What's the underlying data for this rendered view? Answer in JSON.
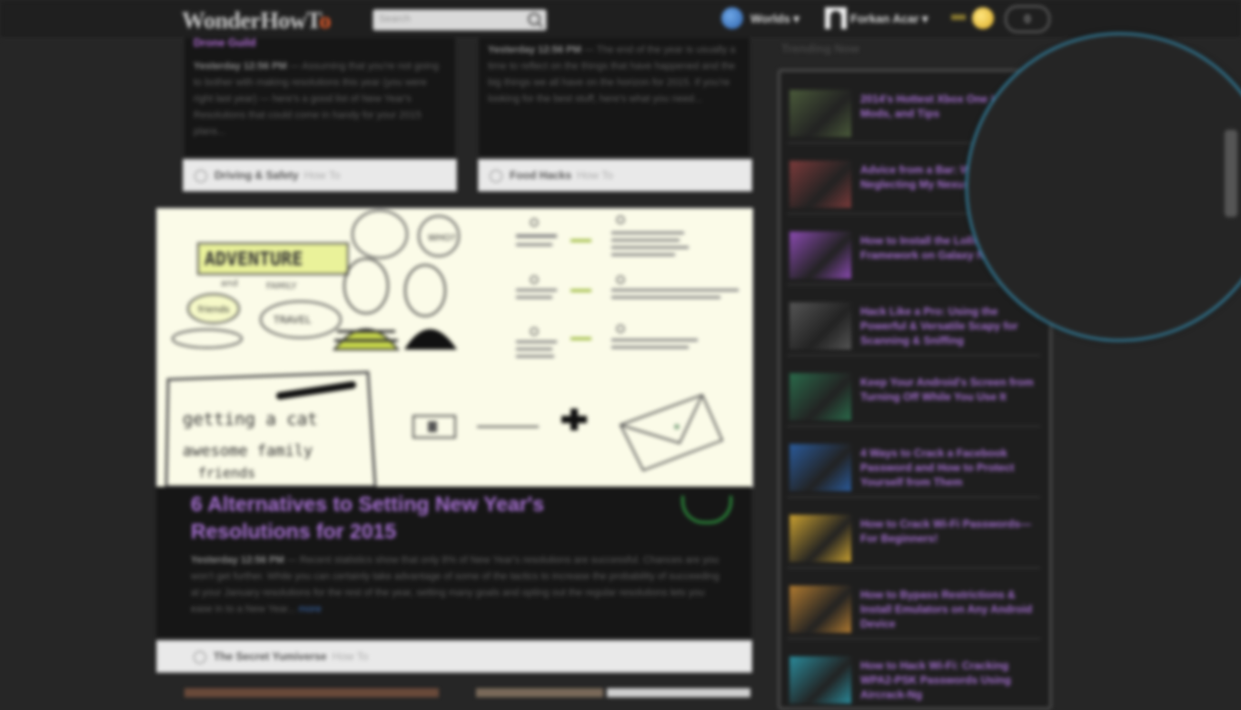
{
  "header": {
    "logo_main": "WonderHowT",
    "logo_o": "o",
    "search_placeholder": "Search",
    "worlds_label": "Worlds ▾",
    "user_name": "Forkan Acar ▾",
    "notifications": "0"
  },
  "cards_top": [
    {
      "author": "Drone Guild",
      "date": "Yesterday 12:56 PM",
      "excerpt": "— Assuming that you're not going to bother with making resolutions this year (you were right last year) — here's a good list of New Year's Resolutions that could come in handy for your 2015 plans...",
      "category": "Driving & Safety",
      "link": "How To"
    },
    {
      "author": "",
      "date": "Yesterday 12:56 PM",
      "excerpt": "— The end of the year is usually a time to reflect on the things that have happened and the big things we all have on the horizon for 2015. If you're looking for the best stuff, here's what you need...",
      "category": "Food Hacks",
      "link": "How To"
    }
  ],
  "feature": {
    "title": "6 Alternatives to Setting New Year's Resolutions for 2015",
    "date": "Yesterday 12:56 PM",
    "excerpt": "— Recent statistics show that only 8% of New Year's resolutions are successful. Chances are you won't get further. While you can certainly take advantage of some of the tactics to increase the probability of succeeding at your January resolutions for the rest of the year, setting many goals and opting out the regular resolutions lets you ease in to a New Year...",
    "more": "more",
    "category": "The Secret Yumiverse",
    "link": "How To",
    "illus_text": {
      "adventure": "ADVENTURE",
      "and": "and",
      "family": "FAMILY",
      "friends": "friends",
      "travel": "TRAVEL",
      "list1": "getting a cat",
      "list2": "awesome family",
      "list3": "friends",
      "bubble": "WHO?"
    }
  },
  "sidebar": {
    "title": "Trending Now",
    "items": [
      {
        "title": "2014's Hottest Xbox One Hacks, Mods, and Tips",
        "color": "#4a5a3a"
      },
      {
        "title": "Advice from a Bar: Why I'm Neglecting My Nexus 5 Again",
        "color": "#7a3a3a"
      },
      {
        "title": "How to Install the Lollipop Framework on Galaxy Note 3",
        "color": "#8a4ab0"
      },
      {
        "title": "Hack Like a Pro: Using the Powerful & Versatile Scapy for Scanning & Sniffing",
        "color": "#555555"
      },
      {
        "title": "Keep Your Android's Screen from Turning Off While You Use It",
        "color": "#2a6a4a"
      },
      {
        "title": "4 Ways to Crack a Facebook Password and How to Protect Yourself from Them",
        "color": "#2a5a9a"
      },
      {
        "title": "How to Crack Wi-Fi Passwords—For Beginners!",
        "color": "#c9a030"
      },
      {
        "title": "How to Bypass Restrictions & Install Emulators on Any Android Device",
        "color": "#b07a30"
      },
      {
        "title": "How to Hack Wi-Fi: Cracking WPA2-PSK Passwords Using Aircrack-Ng",
        "color": "#2a8a9a"
      }
    ]
  }
}
